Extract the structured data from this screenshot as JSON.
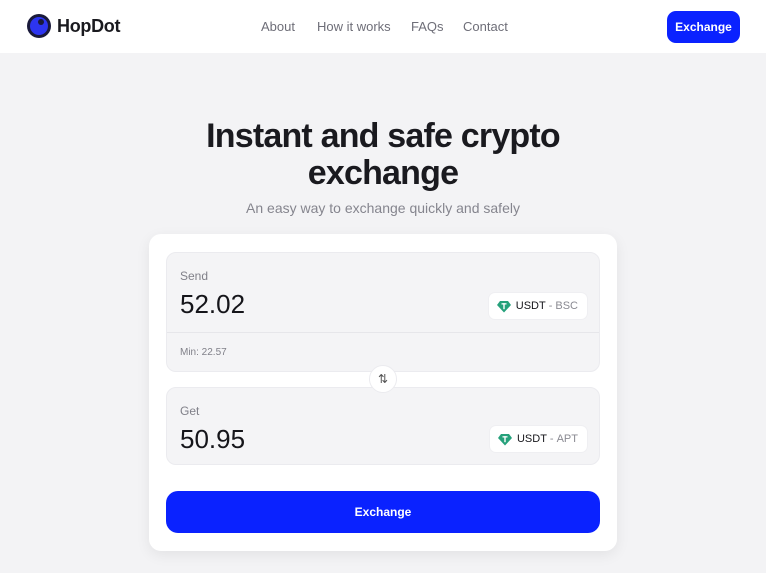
{
  "brand": {
    "name": "HopDot"
  },
  "nav": {
    "items": [
      {
        "label": "About"
      },
      {
        "label": "How it works"
      },
      {
        "label": "FAQs"
      },
      {
        "label": "Contact"
      }
    ]
  },
  "header": {
    "cta_label": "Exchange"
  },
  "hero": {
    "title_line1": "Instant and safe crypto",
    "title_line2": "exchange",
    "subtitle": "An easy way to exchange quickly and safely"
  },
  "send": {
    "label": "Send",
    "amount": "52.02",
    "min": "Min: 22.57",
    "token": {
      "symbol": "USDT",
      "separator": "-",
      "network": "BSC"
    }
  },
  "get": {
    "label": "Get",
    "amount": "50.95",
    "token": {
      "symbol": "USDT",
      "separator": "-",
      "network": "APT"
    }
  },
  "swap_icon": "swap-arrows-icon",
  "token_icon": "tether-gem-icon",
  "exchange_button": {
    "label": "Exchange"
  },
  "colors": {
    "accent": "#0a22ff",
    "token": "#26a17b",
    "background": "#f3f3f5"
  }
}
